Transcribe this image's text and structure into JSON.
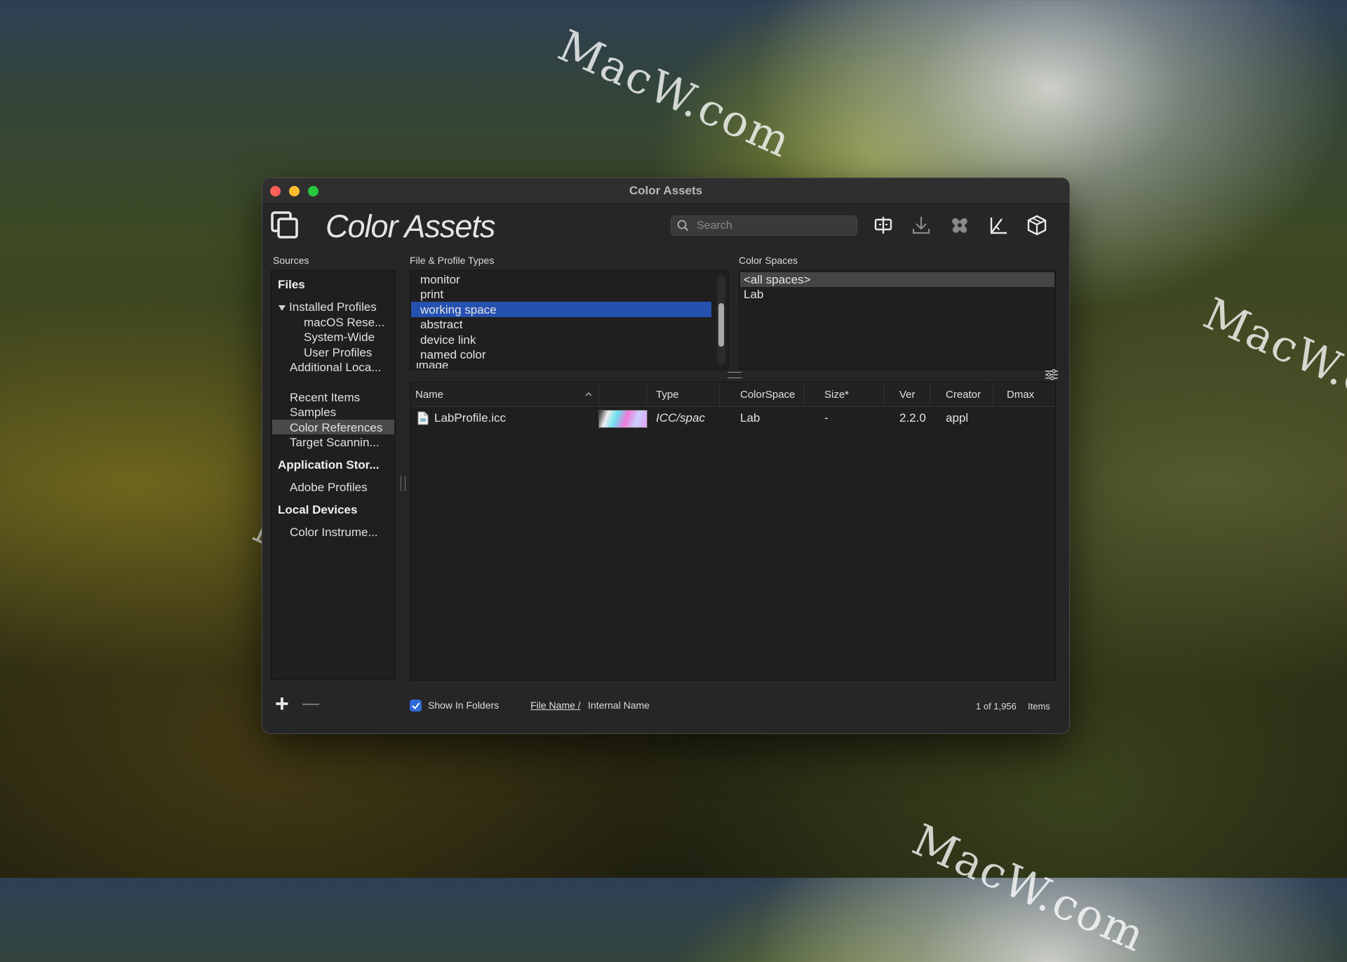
{
  "watermark": "MacW.com",
  "window": {
    "title": "Color Assets"
  },
  "toolbar": {
    "app_title": "Color Assets",
    "search_placeholder": "Search",
    "icons": [
      "collapse-expand-icon",
      "download-icon",
      "tools-icon",
      "ruler-icon",
      "cube-icon"
    ]
  },
  "sources": {
    "label": "Sources",
    "files_heading": "Files",
    "installed_profiles": "Installed Profiles",
    "macos_reserved": "macOS Rese...",
    "system_wide": "System-Wide",
    "user_profiles": "User Profiles",
    "additional_locations": "Additional Loca...",
    "recent_items": "Recent Items",
    "samples": "Samples",
    "color_references": "Color References",
    "target_scanning": "Target Scannin...",
    "application_stores_heading": "Application Stor...",
    "adobe_profiles": "Adobe Profiles",
    "local_devices_heading": "Local Devices",
    "color_instruments": "Color Instrume...",
    "selected": "Color References"
  },
  "file_types": {
    "label": "File & Profile Types",
    "items": [
      "monitor",
      "print",
      "working space",
      "abstract",
      "device link",
      "named color",
      "image"
    ],
    "selected": "working space"
  },
  "color_spaces": {
    "label": "Color Spaces",
    "items": [
      "<all spaces>",
      "Lab"
    ],
    "selected": "<all spaces>"
  },
  "table": {
    "columns": [
      "Name",
      "Type",
      "ColorSpace",
      "Size*",
      "Ver",
      "Creator",
      "Dmax"
    ],
    "rows": [
      {
        "name": "LabProfile.icc",
        "type": "ICC/spac",
        "colorspace": "Lab",
        "size": "-",
        "ver": "2.2.0",
        "creator": "appl",
        "dmax": ""
      }
    ]
  },
  "footer": {
    "add": "+",
    "remove": "—",
    "show_in_folders": "Show In Folders",
    "show_in_folders_checked": true,
    "file_name_link": "File Name /",
    "internal_name": "Internal Name",
    "count": "1 of 1,956",
    "items_label": "Items"
  },
  "colors": {
    "selection": "#2552b0",
    "window_bg": "#262626",
    "panel_bg": "#1f1f1f"
  }
}
